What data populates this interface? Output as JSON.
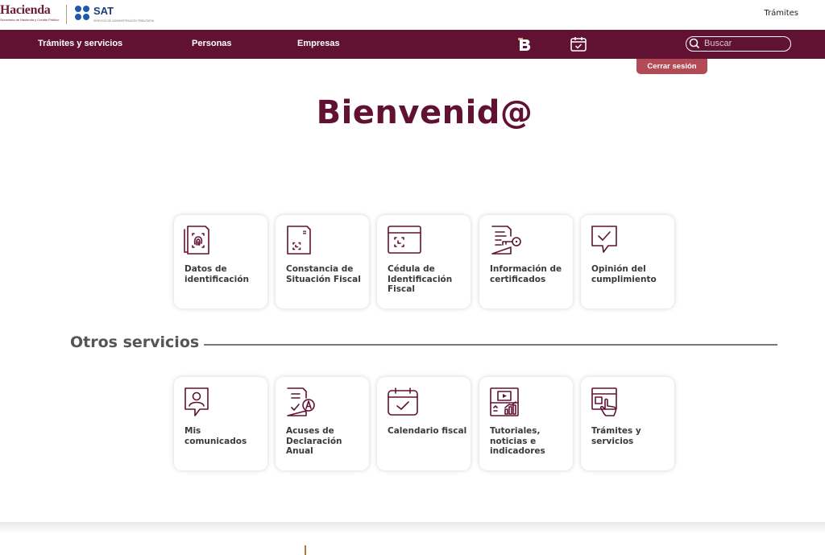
{
  "header": {
    "hacienda_name": "Hacienda",
    "hacienda_sub": "Secretaría de Hacienda y Crédito Público",
    "sat_name": "SAT",
    "sat_sub": "SERVICIO DE ADMINISTRACIÓN TRIBUTARIA",
    "top_link": "Trámites"
  },
  "nav": {
    "items": [
      {
        "label": "Trámites y servicios"
      },
      {
        "label": "Personas"
      },
      {
        "label": "Empresas"
      }
    ],
    "search_placeholder": "Buscar",
    "logout_label": "Cerrar sesión"
  },
  "main": {
    "title": "Bienvenid@",
    "cards": [
      {
        "label": "Datos de identificación",
        "icon": "fingerprint-document-icon"
      },
      {
        "label": "Constancia de Situación Fiscal",
        "icon": "qr-document-icon"
      },
      {
        "label": "Cédula de Identificación Fiscal",
        "icon": "qr-card-icon"
      },
      {
        "label": "Información de certificados",
        "icon": "certificate-key-icon"
      },
      {
        "label": "Opinión del cumplimiento",
        "icon": "check-speech-icon"
      }
    ]
  },
  "other": {
    "title": "Otros servicios",
    "cards": [
      {
        "label": "Mis comunicados",
        "icon": "user-message-icon"
      },
      {
        "label": "Acuses de Declaración Anual",
        "icon": "declaration-receipt-icon"
      },
      {
        "label": "Calendario fiscal",
        "icon": "calendar-check-icon"
      },
      {
        "label": "Tutoriales, noticias e indicadores",
        "icon": "tutorials-chart-icon"
      },
      {
        "label": "Trámites y servicios",
        "icon": "hand-touch-icon"
      }
    ]
  },
  "colors": {
    "brand": "#611232",
    "logout": "#b24b56",
    "sat_blue": "#1e5aa8"
  }
}
